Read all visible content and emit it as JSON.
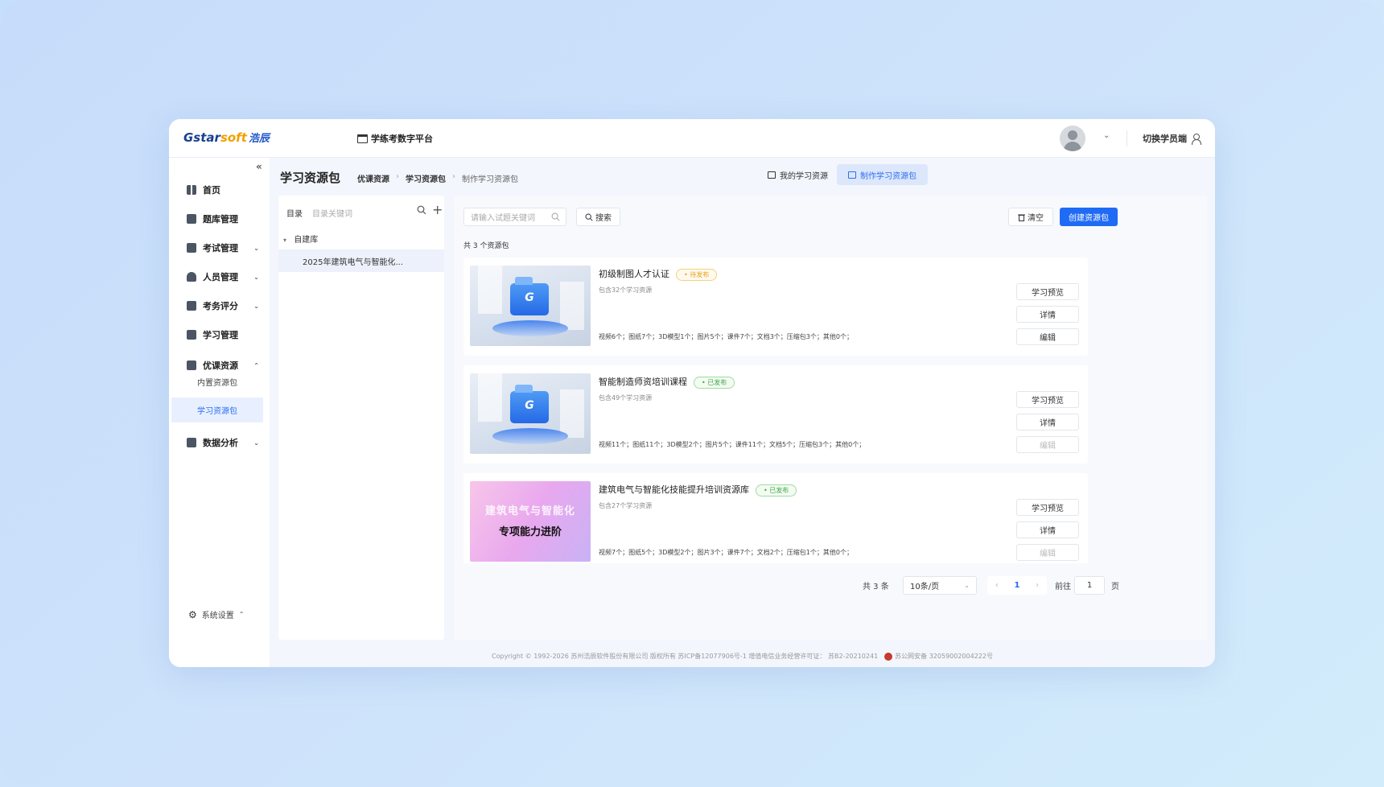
{
  "header": {
    "logo_main": "Gstar",
    "logo_soft": "soft",
    "logo_cn": "浩辰",
    "platform_name": "学练考数字平台",
    "switch_label": "切换学员端"
  },
  "sidebar": {
    "items": [
      {
        "label": "首页"
      },
      {
        "label": "题库管理"
      },
      {
        "label": "考试管理"
      },
      {
        "label": "人员管理"
      },
      {
        "label": "考务评分"
      },
      {
        "label": "学习管理"
      },
      {
        "label": "优课资源"
      },
      {
        "label": "数据分析"
      }
    ],
    "sub_items": [
      {
        "label": "内置资源包"
      },
      {
        "label": "学习资源包"
      }
    ],
    "settings_label": "系统设置"
  },
  "page": {
    "title": "学习资源包",
    "breadcrumb": [
      "优课资源",
      "学习资源包",
      "制作学习资源包"
    ],
    "tabs": [
      {
        "label": "我的学习资源"
      },
      {
        "label": "制作学习资源包"
      }
    ]
  },
  "catalog": {
    "label": "目录",
    "placeholder": "目录关键词",
    "root": "自建库",
    "child": "2025年建筑电气与智能化..."
  },
  "toolbar": {
    "search_placeholder": "请输入试题关键词",
    "search_label": "搜索",
    "clear_label": "清空",
    "create_label": "创建资源包",
    "count_text": "共 3 个资源包"
  },
  "cards": [
    {
      "title": "初级制图人才认证",
      "status": "• 待发布",
      "subtitle": "包含32个学习资源",
      "stats": "视频6个；图纸7个；3D模型1个；图片5个；课件7个；文档3个；压缩包3个；其他0个；",
      "buttons": [
        "学习预览",
        "详情",
        "编辑"
      ]
    },
    {
      "title": "智能制造师资培训课程",
      "status": "• 已发布",
      "subtitle": "包含49个学习资源",
      "stats": "视频11个；图纸11个；3D模型2个；图片5个；课件11个；文档5个；压缩包3个；其他0个；",
      "buttons": [
        "学习预览",
        "详情",
        "编辑"
      ]
    },
    {
      "title": "建筑电气与智能化技能提升培训资源库",
      "status": "• 已发布",
      "subtitle": "包含27个学习资源",
      "stats": "视频7个；图纸5个；3D模型2个；图片3个；课件7个；文档2个；压缩包1个；其他0个；",
      "thumb_line1": "建筑电气与智能化",
      "thumb_line2": "专项能力进阶",
      "buttons": [
        "学习预览",
        "详情",
        "编辑"
      ]
    }
  ],
  "pagination": {
    "total": "共 3 条",
    "page_size": "10条/页",
    "current": "1",
    "goto_label": "前往",
    "goto_value": "1",
    "page_unit": "页"
  },
  "footer": {
    "copyright": "Copyright © 1992-2026 苏州浩辰软件股份有限公司 版权所有 苏ICP备12077906号-1 增值电信业务经营许可证： 苏B2-20210241",
    "police": "苏公网安备 32059002004222号"
  },
  "colors": {
    "primary": "#1f6bf5",
    "pending": "#e9a21a",
    "published": "#3fa74b"
  }
}
